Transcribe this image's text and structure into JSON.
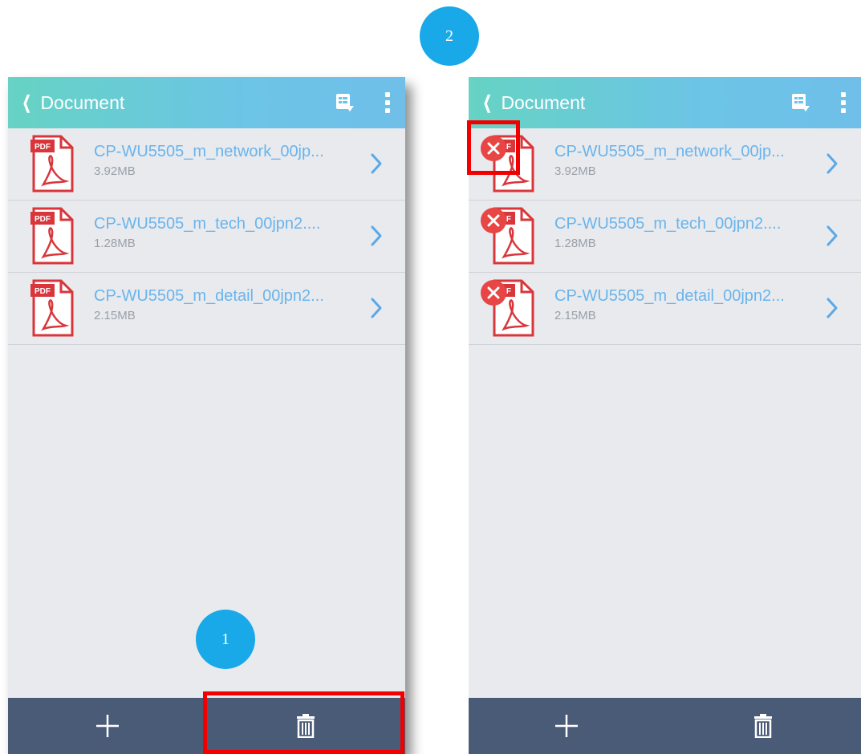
{
  "step_badges": [
    "1",
    "2"
  ],
  "screens": [
    {
      "id": "left",
      "appbar": {
        "back_icon": "chevron-left-icon",
        "title": "Document",
        "action_icons": [
          "document-list-icon",
          "more-vert-icon"
        ]
      },
      "files": [
        {
          "name": "CP-WU5505_m_network_00jp...",
          "size": "3.92MB",
          "icon": "pdf-file-icon",
          "pdf_label": "PDF"
        },
        {
          "name": "CP-WU5505_m_tech_00jpn2....",
          "size": "1.28MB",
          "icon": "pdf-file-icon",
          "pdf_label": "PDF"
        },
        {
          "name": "CP-WU5505_m_detail_00jpn2...",
          "size": "2.15MB",
          "icon": "pdf-file-icon",
          "pdf_label": "PDF"
        }
      ],
      "bottombar": {
        "icons": [
          "add-icon",
          "trash-icon"
        ]
      }
    },
    {
      "id": "right",
      "appbar": {
        "back_icon": "chevron-left-icon",
        "title": "Document",
        "action_icons": [
          "document-list-icon",
          "more-vert-icon"
        ]
      },
      "files": [
        {
          "name": "CP-WU5505_m_network_00jp...",
          "size": "3.92MB",
          "icon": "pdf-file-icon",
          "pdf_label": "PDF",
          "delete_icon": "delete-circle-icon"
        },
        {
          "name": "CP-WU5505_m_tech_00jpn2....",
          "size": "1.28MB",
          "icon": "pdf-file-icon",
          "pdf_label": "PDF",
          "delete_icon": "delete-circle-icon"
        },
        {
          "name": "CP-WU5505_m_detail_00jpn2...",
          "size": "2.15MB",
          "icon": "pdf-file-icon",
          "pdf_label": "PDF",
          "delete_icon": "delete-circle-icon"
        }
      ],
      "bottombar": {
        "icons": [
          "add-icon",
          "trash-icon"
        ]
      }
    }
  ],
  "colors": {
    "step_badge": "#19a8e8",
    "appbar_start": "#66d3c4",
    "appbar_end": "#6fbfe9",
    "file_name": "#6ab4ec",
    "pdf_red": "#d8363b",
    "delete_red": "#e84545",
    "bottombar": "#4a5b78",
    "highlight": "#f20000"
  }
}
